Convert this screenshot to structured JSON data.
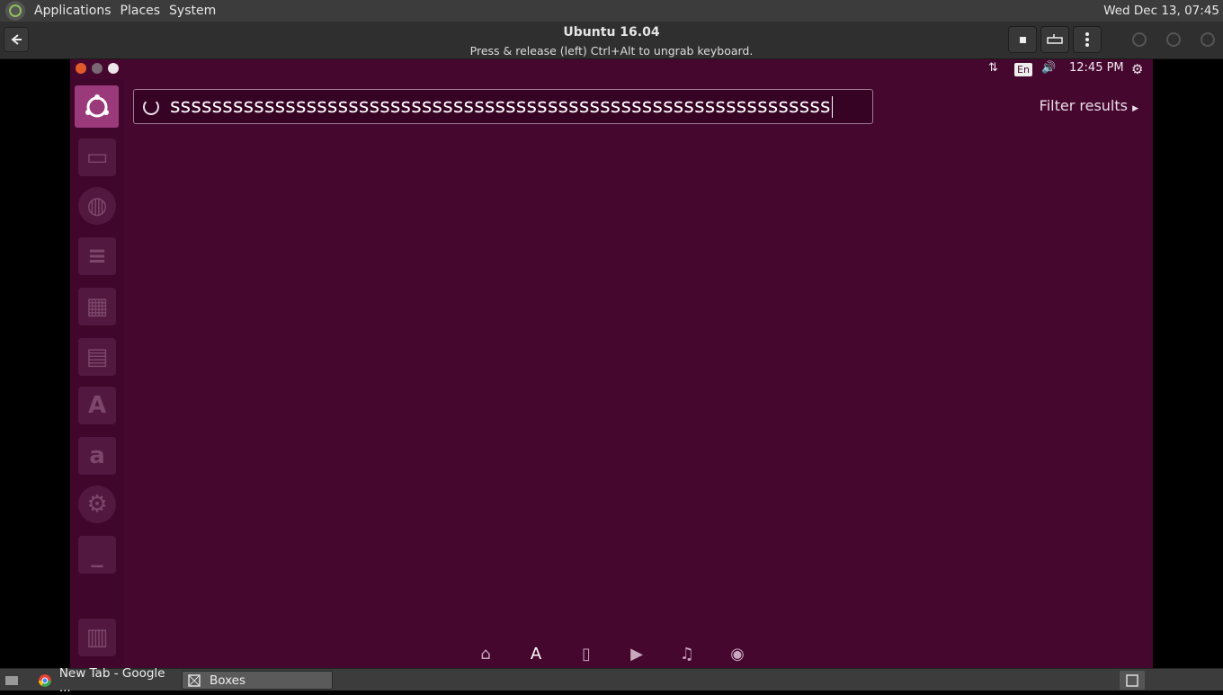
{
  "host_panel": {
    "menus": [
      "Applications",
      "Places",
      "System"
    ],
    "clock": "Wed Dec 13, 07:45"
  },
  "boxes_header": {
    "title": "Ubuntu 16.04",
    "subtitle": "Press & release (left) Ctrl+Alt to ungrab keyboard."
  },
  "vm_panel": {
    "keyboard_layout": "En",
    "time": "12:45 PM"
  },
  "dash": {
    "search_value": "sssssssssssssssssssssssssssssssssssssssssssssssssssssssssssssss",
    "filter_label": "Filter results",
    "launcher_amazon_glyph": "a"
  },
  "taskbar": {
    "tasks": [
      {
        "label": "New Tab - Google ..."
      },
      {
        "label": "Boxes"
      }
    ]
  },
  "colors": {
    "dash_bg": "#46072f",
    "bfb": "#9a3a7a",
    "host_panel": "#3c3c3c"
  }
}
